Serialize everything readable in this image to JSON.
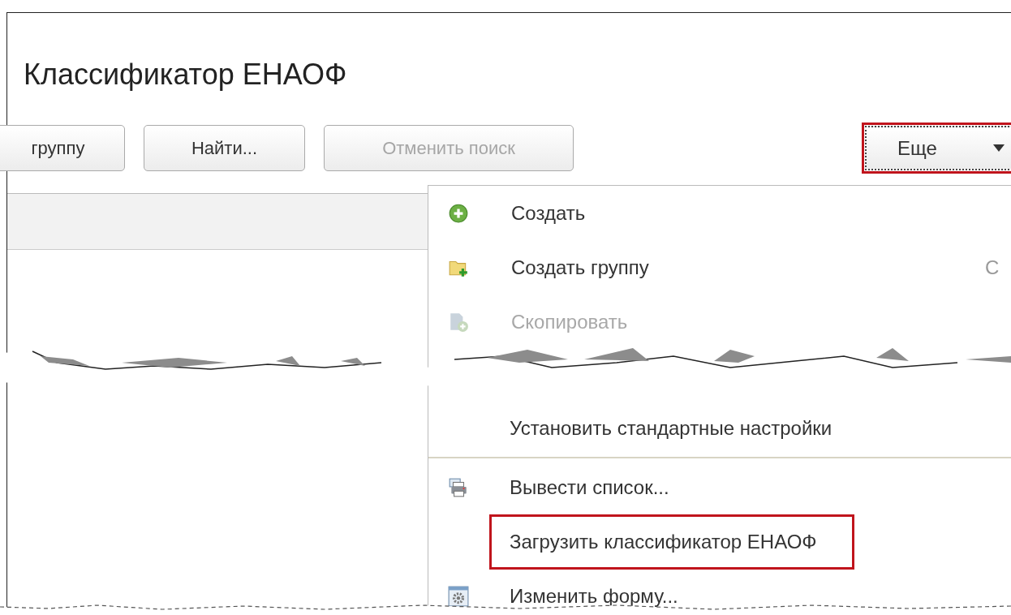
{
  "title": "Классификатор ЕНАОФ",
  "toolbar": {
    "buttons": [
      {
        "label": "группу",
        "disabled": false
      },
      {
        "label": "Найти...",
        "disabled": false
      },
      {
        "label": "Отменить поиск",
        "disabled": true
      }
    ],
    "more_button": {
      "label": "Еще",
      "highlighted": true
    }
  },
  "menu": {
    "items": [
      {
        "kind": "item",
        "label": "Создать",
        "disabled": false,
        "highlighted": false
      },
      {
        "kind": "item",
        "label": "Создать группу",
        "shortcut": "С",
        "disabled": false,
        "highlighted": false
      },
      {
        "kind": "item",
        "label": "Скопировать",
        "disabled": true,
        "highlighted": false
      },
      {
        "kind": "torn"
      },
      {
        "kind": "item",
        "label": "Установить стандартные настройки",
        "disabled": false,
        "highlighted": false
      },
      {
        "kind": "separator"
      },
      {
        "kind": "item",
        "label": "Вывести список...",
        "disabled": false,
        "highlighted": false
      },
      {
        "kind": "item",
        "label": "Загрузить классификатор ЕНАОФ",
        "disabled": false,
        "highlighted": true
      },
      {
        "kind": "item",
        "label": "Изменить форму...",
        "disabled": false,
        "highlighted": false
      }
    ]
  }
}
